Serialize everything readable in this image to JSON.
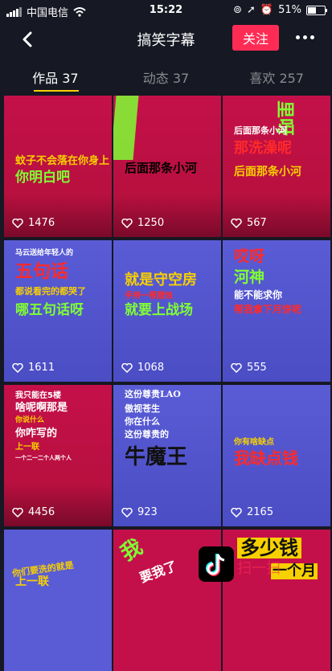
{
  "status_bar": {
    "carrier": "中国电信",
    "time": "15:22",
    "battery": "51%",
    "battery_level": 0.51
  },
  "header": {
    "title": "搞笑字幕",
    "follow_label": "关注"
  },
  "tabs": [
    {
      "label": "作品 37"
    },
    {
      "label": "动态 37"
    },
    {
      "label": "喜欢 257"
    }
  ],
  "videos": [
    {
      "likes": "1476",
      "bg": "#c4104a",
      "captions": [
        "蚊子不会落在你身上",
        "你明白吧"
      ]
    },
    {
      "likes": "1250",
      "bg": "#c4104a",
      "captions": [
        "后面那条小河"
      ]
    },
    {
      "likes": "567",
      "bg": "#c4104a",
      "captions": [
        "里呀",
        "后面那条小河",
        "那洗澡呢",
        "后面那条小河"
      ]
    },
    {
      "likes": "1611",
      "bg": "#5a5cd6",
      "captions": [
        "马云送给年轻人的",
        "五句话",
        "都说看完的都哭了",
        "哪五句话呀"
      ]
    },
    {
      "likes": "1068",
      "bg": "#5a5cd6",
      "captions": [
        "就是守空房",
        "手持一根腊烛",
        "就要上战场"
      ]
    },
    {
      "likes": "555",
      "bg": "#5a5cd6",
      "captions": [
        "哎呀",
        "河神",
        "能不能求你",
        "帮我拿下月饼呢"
      ]
    },
    {
      "likes": "4456",
      "bg": "#c4104a",
      "captions": [
        "我只能在5楼",
        "啥呢啊那是",
        "你说什么",
        "你咋写的",
        "上一联",
        "一个二一二个人两个人"
      ]
    },
    {
      "likes": "923",
      "bg": "#5a5cd6",
      "captions": [
        "这份尊贵LAO",
        "傲视苍生",
        "你在什么",
        "这份尊贵的",
        "牛魔王"
      ]
    },
    {
      "likes": "2165",
      "bg": "#5a5cd6",
      "captions": [
        "你有啥缺点",
        "我缺点钱"
      ]
    },
    {
      "likes": "",
      "bg": "#5a5cd6",
      "captions": [
        "你们要洗的就是",
        "上一联"
      ]
    },
    {
      "likes": "",
      "bg": "#c4104a",
      "captions": [
        "我",
        "要我了"
      ]
    },
    {
      "likes": "",
      "bg": "#c4104a",
      "captions": [
        "多少钱",
        "一个月"
      ]
    }
  ],
  "watermark": {
    "text": "扫一扫"
  }
}
